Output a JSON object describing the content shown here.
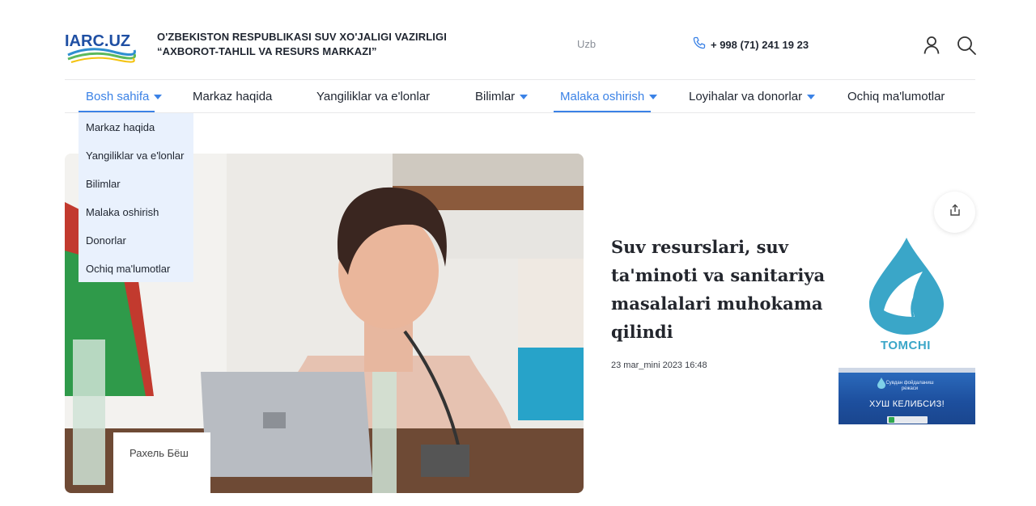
{
  "header": {
    "logo_text": "IARC.UZ",
    "org_line1": "O'ZBEKISTON RESPUBLIKASI SUV XO'JALIGI VAZIRLIGI",
    "org_line2": "“AXBOROT-TAHLIL VA RESURS MARKAZI”",
    "language": "Uzb",
    "phone": "+ 998 (71) 241 19 23",
    "icons": [
      "phone-icon",
      "user-icon",
      "search-icon"
    ]
  },
  "nav": {
    "items": [
      {
        "label": "Bosh sahifa",
        "has_dropdown": true,
        "active": true
      },
      {
        "label": "Markaz haqida",
        "has_dropdown": false
      },
      {
        "label": "Yangiliklar va e'lonlar",
        "has_dropdown": false
      },
      {
        "label": "Bilimlar",
        "has_dropdown": true
      },
      {
        "label": "Malaka oshirish",
        "has_dropdown": true,
        "active": true
      },
      {
        "label": "Loyihalar va donorlar",
        "has_dropdown": true
      },
      {
        "label": "Ochiq ma'lumotlar",
        "has_dropdown": false
      }
    ],
    "dropdown": [
      "Markaz haqida",
      "Yangiliklar va e'lonlar",
      "Bilimlar",
      "Malaka oshirish",
      "Donorlar",
      "Ochiq ma'lumotlar"
    ]
  },
  "feature": {
    "headline": "Suv resurslari, suv ta'minoti va sanitariya masalalari muhokama qilindi",
    "date": "23 mar_mini 2023 16:48",
    "photo_nameplate": "Рахель Бёш"
  },
  "sidebar": {
    "tomchi_label": "TOMCHI",
    "banner_subtitle": "Сувдан фойдаланиш режаси",
    "banner_title": "ХУШ КЕЛИБСИЗ!"
  },
  "colors": {
    "accent": "#3b82e6",
    "dropdown_bg": "#e9f1fd",
    "tomchi": "#3aa6c8",
    "banner": "#1d4f9e"
  }
}
